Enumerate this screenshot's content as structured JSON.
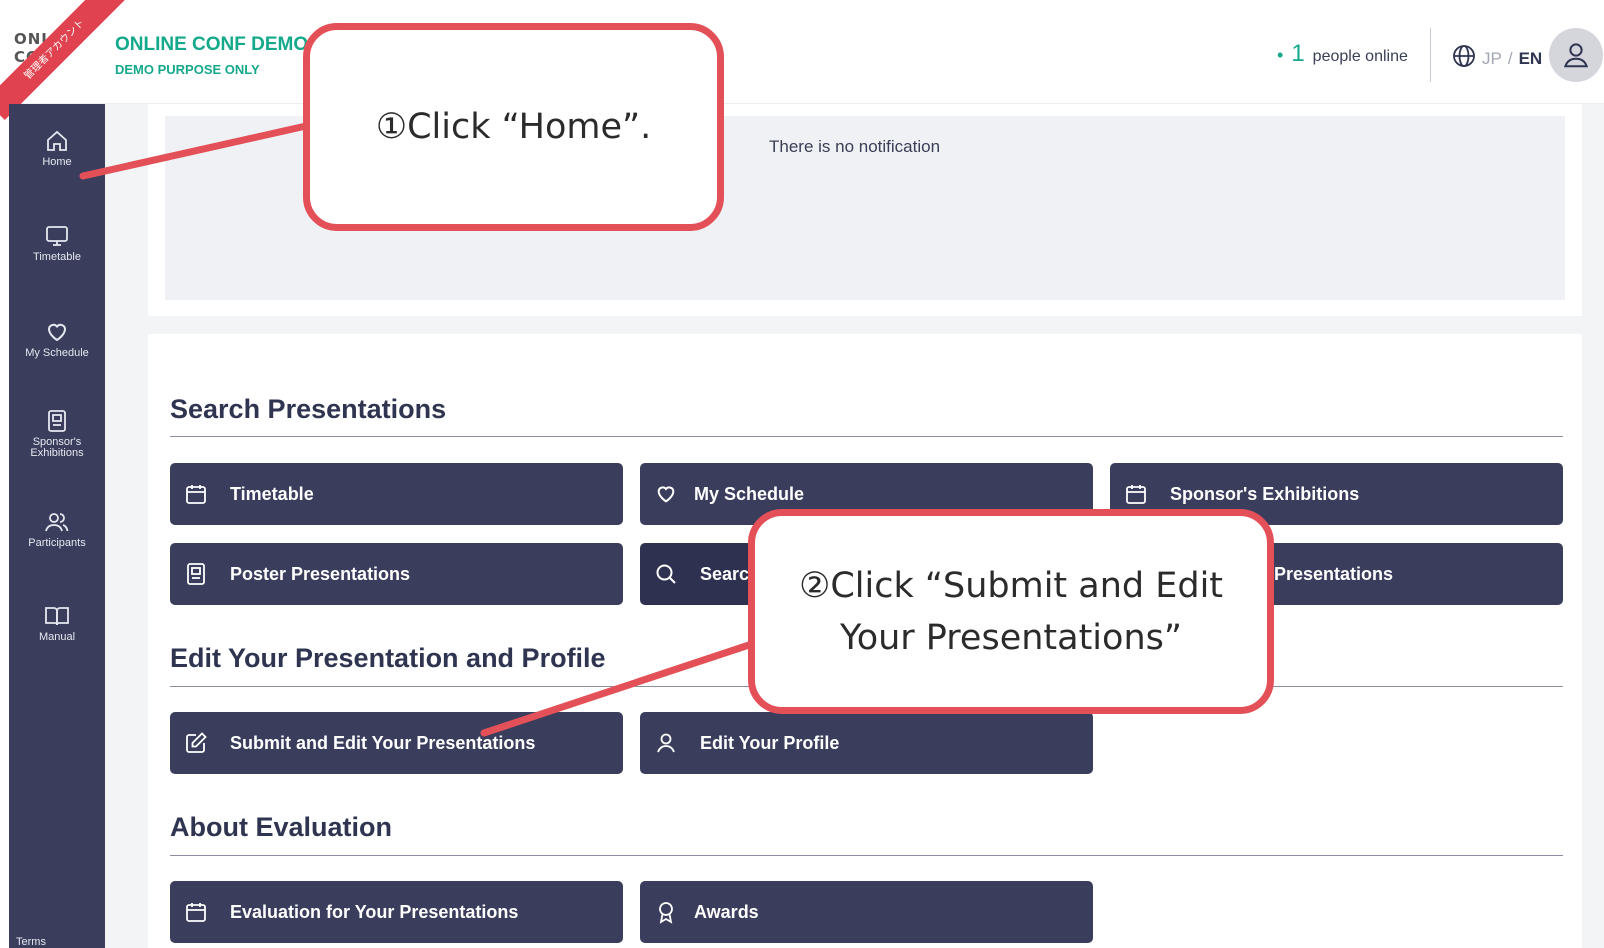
{
  "header": {
    "logo_text": "ONLINE CONF",
    "admin_ribbon": "管理者アカウント",
    "brand_title": "ONLINE CONF DEMO",
    "brand_subtitle": "DEMO PURPOSE ONLY",
    "online_dot": "•",
    "online_count": "1",
    "online_label": "people online",
    "lang_jp": "JP",
    "lang_sep": "/",
    "lang_en": "EN"
  },
  "sidebar": {
    "items": [
      {
        "label": "Home",
        "icon": "home-icon"
      },
      {
        "label": "Timetable",
        "icon": "monitor-icon"
      },
      {
        "label": "My Schedule",
        "icon": "heart-icon"
      },
      {
        "label": "Sponsor's Exhibitions",
        "icon": "poster-icon"
      },
      {
        "label": "Participants",
        "icon": "people-icon"
      },
      {
        "label": "Manual",
        "icon": "book-icon"
      }
    ],
    "terms": "Terms"
  },
  "notification": {
    "text": "There is no notification"
  },
  "sections": {
    "search_title": "Search Presentations",
    "search_tiles": [
      {
        "label": "Timetable",
        "icon": "calendar-icon"
      },
      {
        "label": "My Schedule",
        "icon": "heart-icon"
      },
      {
        "label": "Sponsor's Exhibitions",
        "icon": "calendar-icon"
      },
      {
        "label": "Poster Presentations",
        "icon": "poster-icon"
      },
      {
        "label": "Searc",
        "icon": "search-icon"
      },
      {
        "label": "Presentations",
        "icon": ""
      }
    ],
    "edit_title": "Edit Your Presentation and Profile",
    "edit_tiles": [
      {
        "label": "Submit and Edit Your Presentations",
        "icon": "edit-icon"
      },
      {
        "label": "Edit Your Profile",
        "icon": "user-icon"
      }
    ],
    "eval_title": "About Evaluation",
    "eval_tiles": [
      {
        "label": "Evaluation for Your Presentations",
        "icon": "calendar-icon"
      },
      {
        "label": "Awards",
        "icon": "award-icon"
      }
    ]
  },
  "callouts": {
    "step1": "①Click “Home”.",
    "step2_line1": "②Click “Submit and Edit",
    "step2_line2": "Your Presentations”"
  },
  "colors": {
    "sidebar": "#3a3d5c",
    "accent": "#15a98c",
    "callout_border": "#e45058"
  }
}
